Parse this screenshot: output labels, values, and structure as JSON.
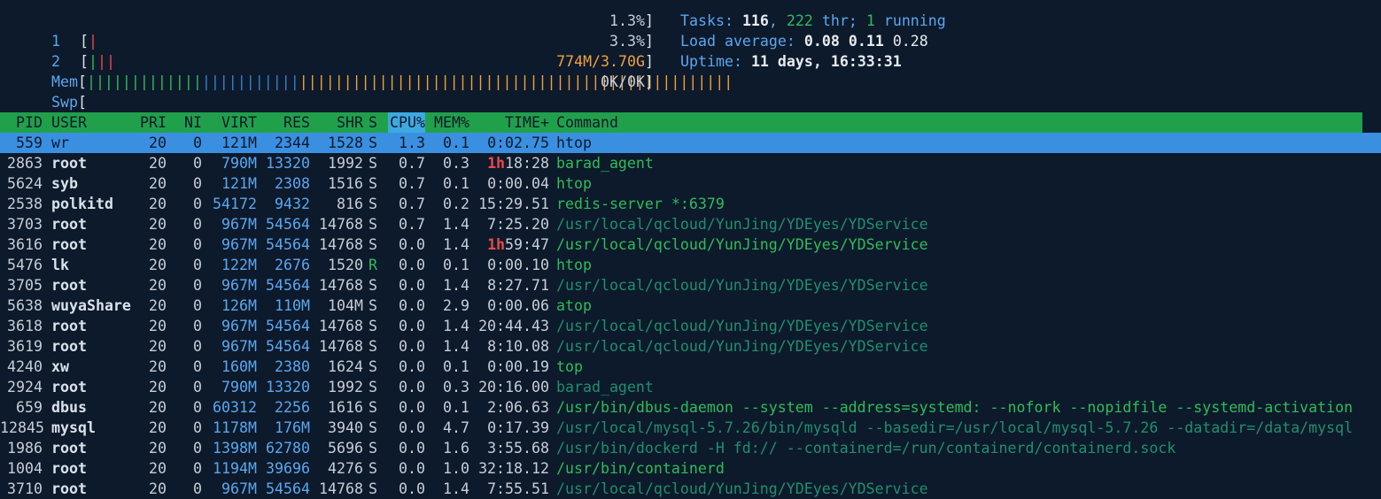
{
  "meters": {
    "cpu1": {
      "label": "1",
      "bar_red": "|",
      "value": "1.3%"
    },
    "cpu2": {
      "label": "2",
      "bar_green": "|",
      "bar_red": "||",
      "value": "3.3%"
    },
    "mem": {
      "label": "Mem",
      "bar_green": "|||||||||||||",
      "bar_blue": "|||||||||||",
      "bar_orange": "|||||||||||||||||||||||||||||||||||||||||||||||||",
      "value": "774M/3.70G"
    },
    "swp": {
      "label": "Swp",
      "value": "0K/0K"
    }
  },
  "summary": {
    "tasks_label": "Tasks: ",
    "tasks": "116",
    "thr": "222",
    "thr_label": " thr; ",
    "running": "1",
    "running_label": " running",
    "load_label": "Load average: ",
    "load1": "0.08",
    "load5": "0.11",
    "load15": "0.28",
    "uptime_label": "Uptime: ",
    "uptime": "11 days, 16:33:31"
  },
  "columns": {
    "pid": "PID",
    "user": "USER",
    "pri": "PRI",
    "ni": "NI",
    "virt": "VIRT",
    "res": "RES",
    "shr": "SHR",
    "s": "S",
    "cpu": "CPU%",
    "mem": "MEM%",
    "time": "TIME+",
    "cmd": "Command"
  },
  "processes": [
    {
      "pid": "559",
      "user": "wr",
      "pri": "20",
      "ni": "0",
      "virt": "121M",
      "res": "2344",
      "shr": "1528",
      "s": "S",
      "cpu": "1.3",
      "mem": "0.1",
      "time": "0:02.75",
      "cmd": "htop",
      "selected": true
    },
    {
      "pid": "2863",
      "user": "root",
      "pri": "20",
      "ni": "0",
      "virt": "790M",
      "res": "13320",
      "shr": "1992",
      "s": "S",
      "cpu": "0.7",
      "mem": "0.3",
      "time_h": "1h",
      "time": "18:28",
      "cmd": "barad_agent"
    },
    {
      "pid": "5624",
      "user": "syb",
      "pri": "20",
      "ni": "0",
      "virt": "121M",
      "res": "2308",
      "shr": "1516",
      "s": "S",
      "cpu": "0.7",
      "mem": "0.1",
      "time": "0:00.04",
      "cmd": "htop"
    },
    {
      "pid": "2538",
      "user": "polkitd",
      "pri": "20",
      "ni": "0",
      "virt": "54172",
      "res": "9432",
      "shr": "816",
      "s": "S",
      "cpu": "0.7",
      "mem": "0.2",
      "time": "15:29.51",
      "cmd": "redis-server *:6379"
    },
    {
      "pid": "3703",
      "user": "root",
      "pri": "20",
      "ni": "0",
      "virt": "967M",
      "res": "54564",
      "shr": "14768",
      "s": "S",
      "cpu": "0.7",
      "mem": "1.4",
      "time": "7:25.20",
      "cmd": "/usr/local/qcloud/YunJing/YDEyes/YDService",
      "thread": true
    },
    {
      "pid": "3616",
      "user": "root",
      "pri": "20",
      "ni": "0",
      "virt": "967M",
      "res": "54564",
      "shr": "14768",
      "s": "S",
      "cpu": "0.0",
      "mem": "1.4",
      "time_h": "1h",
      "time": "59:47",
      "cmd": "/usr/local/qcloud/YunJing/YDEyes/YDService"
    },
    {
      "pid": "5476",
      "user": "lk",
      "pri": "20",
      "ni": "0",
      "virt": "122M",
      "res": "2676",
      "shr": "1520",
      "s": "R",
      "cpu": "0.0",
      "mem": "0.1",
      "time": "0:00.10",
      "cmd": "htop"
    },
    {
      "pid": "3705",
      "user": "root",
      "pri": "20",
      "ni": "0",
      "virt": "967M",
      "res": "54564",
      "shr": "14768",
      "s": "S",
      "cpu": "0.0",
      "mem": "1.4",
      "time": "8:27.71",
      "cmd": "/usr/local/qcloud/YunJing/YDEyes/YDService",
      "thread": true
    },
    {
      "pid": "5638",
      "user": "wuyaShare",
      "pri": "20",
      "ni": "0",
      "virt": "126M",
      "res": "110M",
      "shr": "104M",
      "s": "S",
      "cpu": "0.0",
      "mem": "2.9",
      "time": "0:00.06",
      "cmd": "atop"
    },
    {
      "pid": "3618",
      "user": "root",
      "pri": "20",
      "ni": "0",
      "virt": "967M",
      "res": "54564",
      "shr": "14768",
      "s": "S",
      "cpu": "0.0",
      "mem": "1.4",
      "time": "20:44.43",
      "cmd": "/usr/local/qcloud/YunJing/YDEyes/YDService",
      "thread": true
    },
    {
      "pid": "3619",
      "user": "root",
      "pri": "20",
      "ni": "0",
      "virt": "967M",
      "res": "54564",
      "shr": "14768",
      "s": "S",
      "cpu": "0.0",
      "mem": "1.4",
      "time": "8:10.08",
      "cmd": "/usr/local/qcloud/YunJing/YDEyes/YDService",
      "thread": true
    },
    {
      "pid": "4240",
      "user": "xw",
      "pri": "20",
      "ni": "0",
      "virt": "160M",
      "res": "2380",
      "shr": "1624",
      "s": "S",
      "cpu": "0.0",
      "mem": "0.1",
      "time": "0:00.19",
      "cmd": "top"
    },
    {
      "pid": "2924",
      "user": "root",
      "pri": "20",
      "ni": "0",
      "virt": "790M",
      "res": "13320",
      "shr": "1992",
      "s": "S",
      "cpu": "0.0",
      "mem": "0.3",
      "time": "20:16.00",
      "cmd": "barad_agent",
      "thread": true
    },
    {
      "pid": "659",
      "user": "dbus",
      "pri": "20",
      "ni": "0",
      "virt": "60312",
      "res": "2256",
      "shr": "1616",
      "s": "S",
      "cpu": "0.0",
      "mem": "0.1",
      "time": "2:06.63",
      "cmd": "/usr/bin/dbus-daemon --system --address=systemd: --nofork --nopidfile --systemd-activation"
    },
    {
      "pid": "12845",
      "user": "mysql",
      "pri": "20",
      "ni": "0",
      "virt": "1178M",
      "res": "176M",
      "shr": "3940",
      "s": "S",
      "cpu": "0.0",
      "mem": "4.7",
      "time": "0:17.39",
      "cmd": "/usr/local/mysql-5.7.26/bin/mysqld --basedir=/usr/local/mysql-5.7.26 --datadir=/data/mysql",
      "thread": true
    },
    {
      "pid": "1986",
      "user": "root",
      "pri": "20",
      "ni": "0",
      "virt": "1398M",
      "res": "62780",
      "shr": "5696",
      "s": "S",
      "cpu": "0.0",
      "mem": "1.6",
      "time": "3:55.68",
      "cmd": "/usr/bin/dockerd -H fd:// --containerd=/run/containerd/containerd.sock",
      "thread": true
    },
    {
      "pid": "1004",
      "user": "root",
      "pri": "20",
      "ni": "0",
      "virt": "1194M",
      "res": "39696",
      "shr": "4276",
      "s": "S",
      "cpu": "0.0",
      "mem": "1.0",
      "time": "32:18.12",
      "cmd": "/usr/bin/containerd"
    },
    {
      "pid": "3710",
      "user": "root",
      "pri": "20",
      "ni": "0",
      "virt": "967M",
      "res": "54564",
      "shr": "14768",
      "s": "S",
      "cpu": "0.0",
      "mem": "1.4",
      "time": "7:55.51",
      "cmd": "/usr/local/qcloud/YunJing/YDEyes/YDService",
      "thread": true
    }
  ],
  "colors": {
    "background": "#0d1a2b",
    "header_bg": "#21a04b",
    "selection_bg": "#3a8fe0",
    "cpu_col_hl": "#3ea8e0"
  }
}
